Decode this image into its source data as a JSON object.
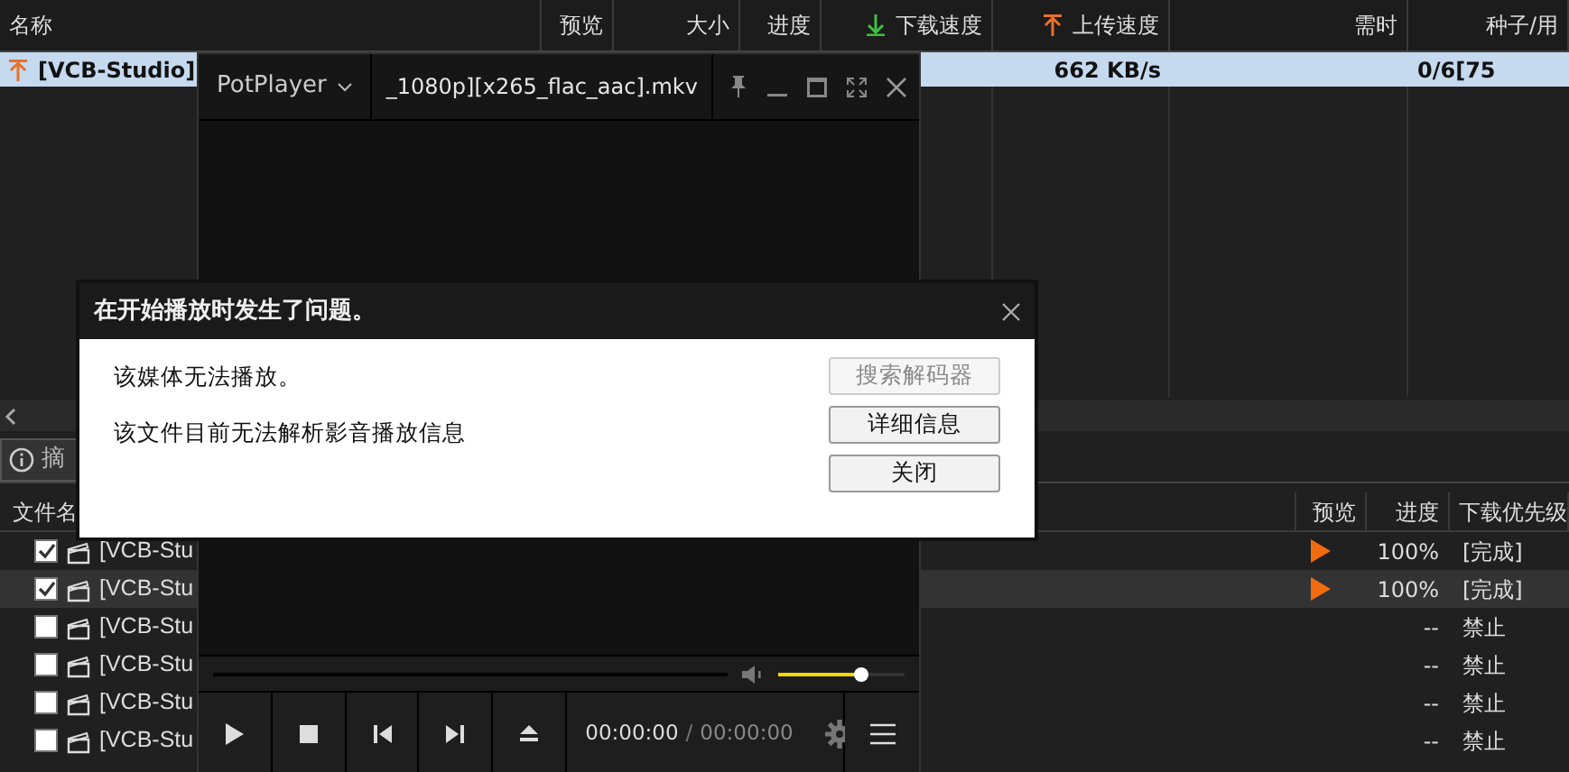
{
  "torrent_list": {
    "columns": [
      "名称",
      "预览",
      "大小",
      "进度",
      "下载速度",
      "上传速度",
      "需时",
      "种子/用"
    ],
    "rows": [
      {
        "name": "[VCB-Studio]",
        "upload_speed": "662 KB/s",
        "seeds": "0/6[75",
        "selected": true
      }
    ]
  },
  "detail_tabs": [
    {
      "label": "摘",
      "selected": true
    }
  ],
  "files": {
    "columns": [
      "文件名",
      "预览",
      "进度",
      "下载优先级"
    ],
    "rows": [
      {
        "name": "[VCB-Stu",
        "checked": true,
        "selected": false,
        "preview": true,
        "progress": "100%",
        "priority": "[完成]"
      },
      {
        "name": "[VCB-Stu",
        "checked": true,
        "selected": true,
        "preview": true,
        "progress": "100%",
        "priority": "[完成]"
      },
      {
        "name": "[VCB-Stu",
        "checked": false,
        "selected": false,
        "preview": false,
        "progress": "--",
        "priority": "禁止"
      },
      {
        "name": "[VCB-Stu",
        "checked": false,
        "selected": false,
        "preview": false,
        "progress": "--",
        "priority": "禁止"
      },
      {
        "name": "[VCB-Stu",
        "checked": false,
        "selected": false,
        "preview": false,
        "progress": "--",
        "priority": "禁止"
      },
      {
        "name": "[VCB-Stu",
        "checked": false,
        "selected": false,
        "preview": false,
        "progress": "--",
        "priority": "禁止"
      }
    ]
  },
  "player": {
    "title": "PotPlayer",
    "file_tab": "_1080p][x265_flac_aac].mkv",
    "volume": {
      "level": 0.66
    },
    "time_current": "00:00:00",
    "time_separator": "/",
    "time_total": "00:00:00"
  },
  "dialog": {
    "title": "在开始播放时发生了问题。",
    "messages": [
      "该媒体无法播放。",
      "该文件目前无法解析影音播放信息"
    ],
    "buttons": [
      {
        "label": "搜索解码器",
        "disabled": true
      },
      {
        "label": "详细信息",
        "disabled": false
      },
      {
        "label": "关闭",
        "disabled": false
      }
    ]
  }
}
